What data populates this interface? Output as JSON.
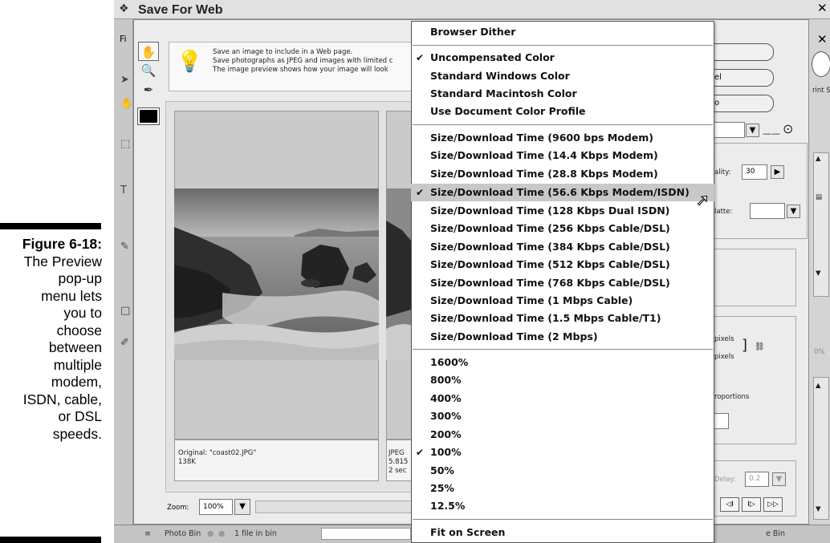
{
  "caption": {
    "figure": "Figure 6-18:",
    "text_lines": [
      "The Preview",
      "pop-up",
      "menu lets",
      "you to",
      "choose",
      "between",
      "multiple",
      "modem,",
      "ISDN, cable,",
      "or DSL",
      "speeds."
    ]
  },
  "dialog": {
    "title": "Save For Web",
    "file_menu": "Fi",
    "close": "✕",
    "tip_lines": [
      "Save an image to include in a Web page.",
      "Save photographs as JPEG and images with limited c",
      "The image preview shows how your image will look"
    ],
    "original_caption": "Original: \"coast02.JPG\"",
    "original_size": "138K",
    "optimized_lines": [
      "JPEG",
      "5.815",
      "2 sec"
    ],
    "zoom_label": "Zoom:",
    "zoom_value": "100%"
  },
  "right_panel": {
    "button_2_partial": "el",
    "button_3_partial": "o",
    "quality_label": "ality:",
    "quality_value": "30",
    "matte_label": "latte:",
    "width_label": "pixels",
    "height_label": "pixels",
    "proportions_label": "roportions",
    "delay_label": "Delay:",
    "delay_value": "0.2",
    "percent_partial": "0%",
    "print_partial": "rint S"
  },
  "statusbar": {
    "photo_bin": "Photo Bin",
    "files_in_bin": "1 file in bin",
    "bin_right": "e Bin"
  },
  "menu": {
    "items": [
      {
        "label": "Browser Dither",
        "checked": false
      },
      {
        "label": "Uncompensated Color",
        "checked": true
      },
      {
        "label": "Standard Windows Color",
        "checked": false
      },
      {
        "label": "Standard Macintosh Color",
        "checked": false
      },
      {
        "label": "Use Document Color Profile",
        "checked": false
      },
      {
        "label": "Size/Download Time (9600 bps Modem)",
        "checked": false
      },
      {
        "label": "Size/Download Time (14.4 Kbps Modem)",
        "checked": false
      },
      {
        "label": "Size/Download Time (28.8 Kbps Modem)",
        "checked": false
      },
      {
        "label": "Size/Download Time (56.6 Kbps Modem/ISDN)",
        "checked": true,
        "highlighted": true
      },
      {
        "label": "Size/Download Time (128 Kbps Dual ISDN)",
        "checked": false
      },
      {
        "label": "Size/Download Time (256 Kbps Cable/DSL)",
        "checked": false
      },
      {
        "label": "Size/Download Time (384 Kbps Cable/DSL)",
        "checked": false
      },
      {
        "label": "Size/Download Time (512 Kbps Cable/DSL)",
        "checked": false
      },
      {
        "label": "Size/Download Time (768 Kbps Cable/DSL)",
        "checked": false
      },
      {
        "label": "Size/Download Time (1 Mbps Cable)",
        "checked": false
      },
      {
        "label": "Size/Download Time (1.5 Mbps Cable/T1)",
        "checked": false
      },
      {
        "label": "Size/Download Time (2 Mbps)",
        "checked": false
      },
      {
        "label": "1600%",
        "checked": false
      },
      {
        "label": "800%",
        "checked": false
      },
      {
        "label": "400%",
        "checked": false
      },
      {
        "label": "300%",
        "checked": false
      },
      {
        "label": "200%",
        "checked": false
      },
      {
        "label": "100%",
        "checked": true
      },
      {
        "label": "50%",
        "checked": false
      },
      {
        "label": "25%",
        "checked": false
      },
      {
        "label": "12.5%",
        "checked": false
      },
      {
        "label": "Fit on Screen",
        "checked": false
      }
    ],
    "check_glyph": "✔"
  }
}
